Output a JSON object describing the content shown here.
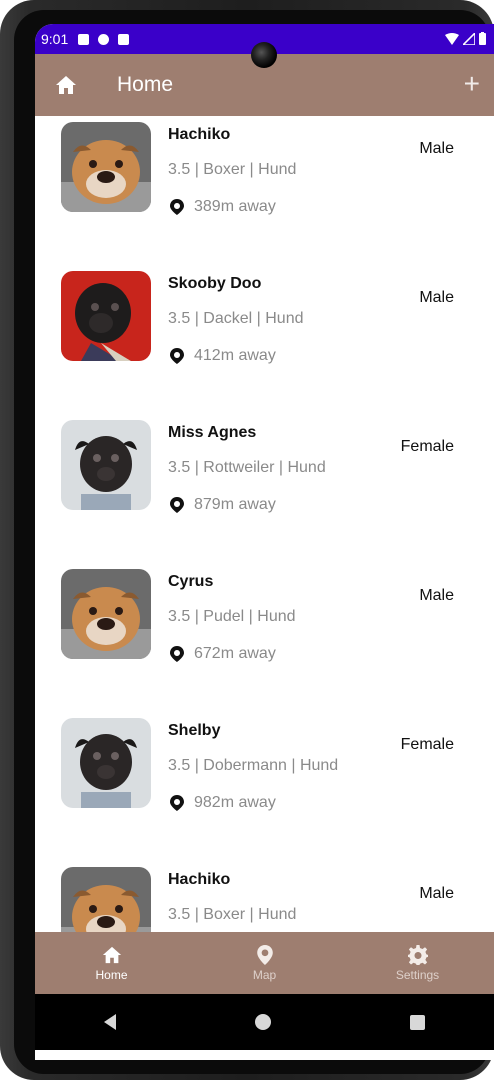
{
  "status_bar": {
    "time": "9:01",
    "left_icons": [
      "notification-icon",
      "sync-icon",
      "sd-card-icon"
    ],
    "right_icons": [
      "wifi-icon",
      "signal-icon",
      "battery-icon"
    ],
    "background": "#3a00c9"
  },
  "app_bar": {
    "title": "Home",
    "home_icon": "home-icon",
    "action_label": "+",
    "background": "#9e7e70"
  },
  "dogs": [
    {
      "name": "Hachiko",
      "meta": "3.5 | Boxer | Hund",
      "distance": "389m away",
      "gender": "Male",
      "photo": "bulldog"
    },
    {
      "name": "Skooby Doo",
      "meta": "3.5 | Dackel | Hund",
      "distance": "412m away",
      "gender": "Male",
      "photo": "pug-red"
    },
    {
      "name": "Miss Agnes",
      "meta": "3.5 | Rottweiler | Hund",
      "distance": "879m away",
      "gender": "Female",
      "photo": "pug-grey"
    },
    {
      "name": "Cyrus",
      "meta": "3.5 | Pudel | Hund",
      "distance": "672m away",
      "gender": "Male",
      "photo": "bulldog"
    },
    {
      "name": "Shelby",
      "meta": "3.5 | Dobermann | Hund",
      "distance": "982m away",
      "gender": "Female",
      "photo": "pug-grey"
    },
    {
      "name": "Hachiko",
      "meta": "3.5 | Boxer | Hund",
      "distance": "",
      "gender": "Male",
      "photo": "bulldog"
    }
  ],
  "bottom_nav": {
    "items": [
      {
        "label": "Home",
        "icon": "home-icon",
        "active": true
      },
      {
        "label": "Map",
        "icon": "map-pin-icon",
        "active": false
      },
      {
        "label": "Settings",
        "icon": "gear-icon",
        "active": false
      }
    ]
  },
  "colors": {
    "accent": "#9e7e70",
    "status_bar": "#3a00c9",
    "secondary_text": "#8a8a8a"
  }
}
